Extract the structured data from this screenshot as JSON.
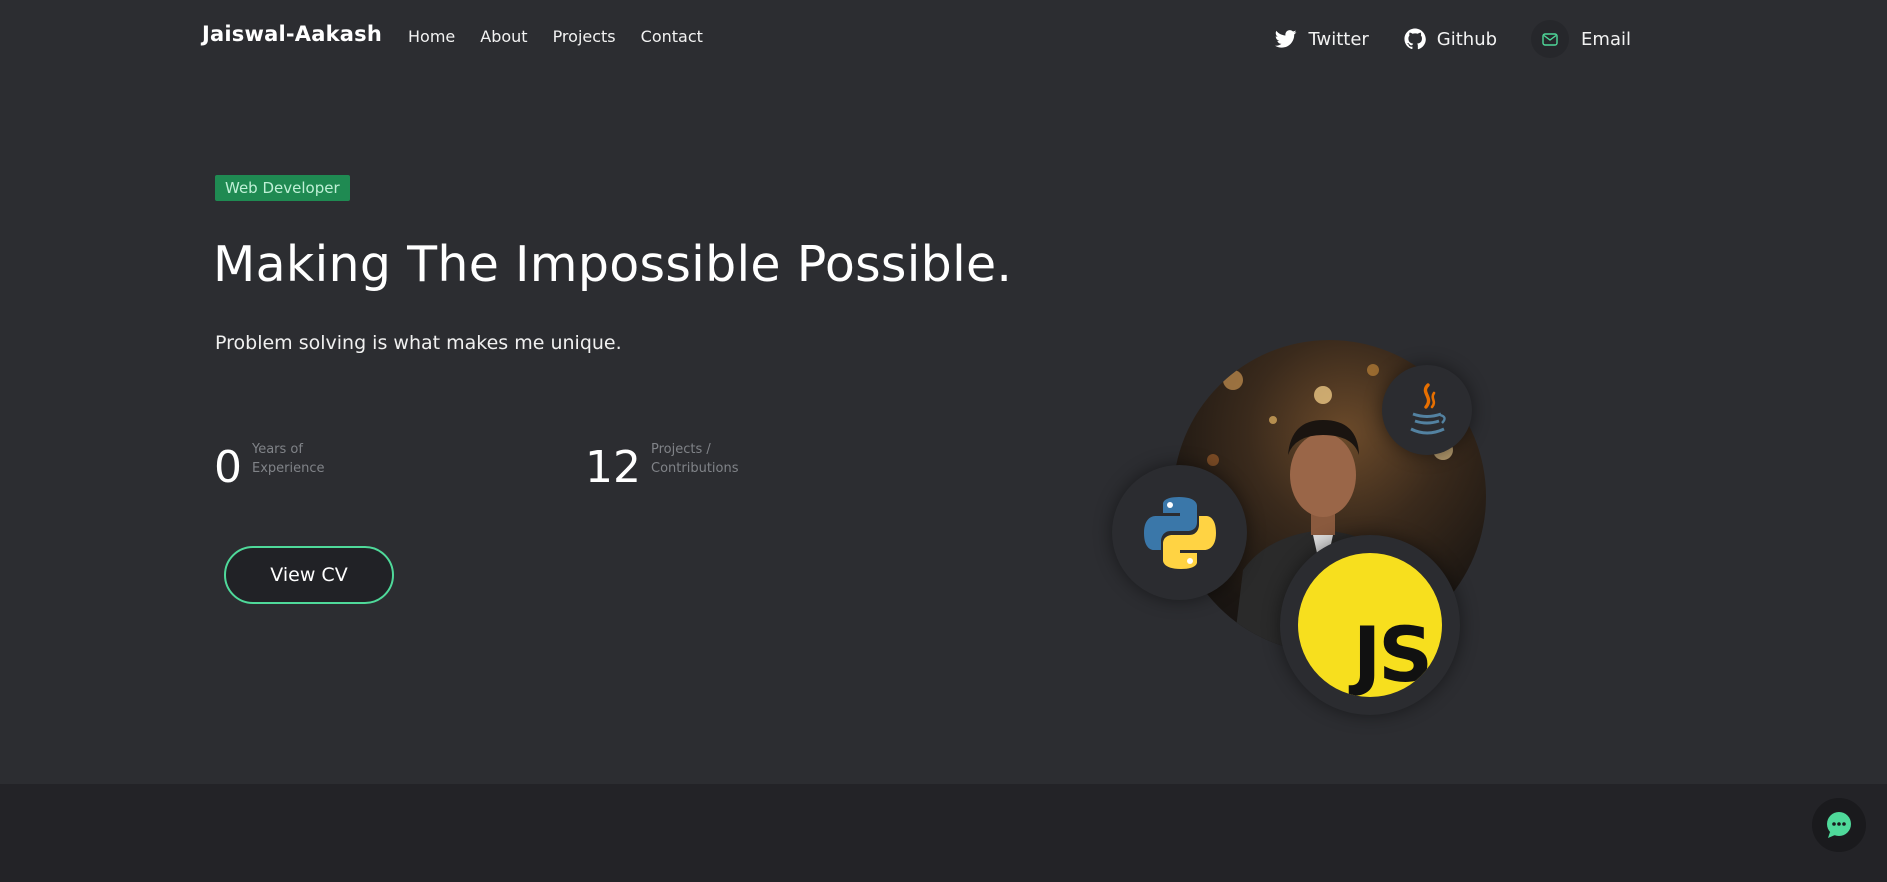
{
  "nav": {
    "brand": "Jaiswal-Aakash",
    "links": [
      "Home",
      "About",
      "Projects",
      "Contact"
    ],
    "socials": [
      {
        "label": "Twitter",
        "icon": "twitter-icon"
      },
      {
        "label": "Github",
        "icon": "github-icon"
      },
      {
        "label": "Email",
        "icon": "mail-icon"
      }
    ]
  },
  "hero": {
    "badge": "Web Developer",
    "headline": "Making The Impossible Possible.",
    "subline": "Problem solving is what makes me unique.",
    "stats": [
      {
        "value": "0",
        "label": "Years of Experience"
      },
      {
        "value": "12",
        "label": "Projects / Contributions"
      }
    ],
    "cta": "View CV"
  },
  "tech_icons": [
    "java-icon",
    "python-icon",
    "javascript-icon"
  ],
  "js_logo_text": "JS",
  "colors": {
    "background": "#2c2d31",
    "accent": "#4fd99a",
    "badge_bg": "#1f8a52",
    "js_yellow": "#f7df1e"
  }
}
